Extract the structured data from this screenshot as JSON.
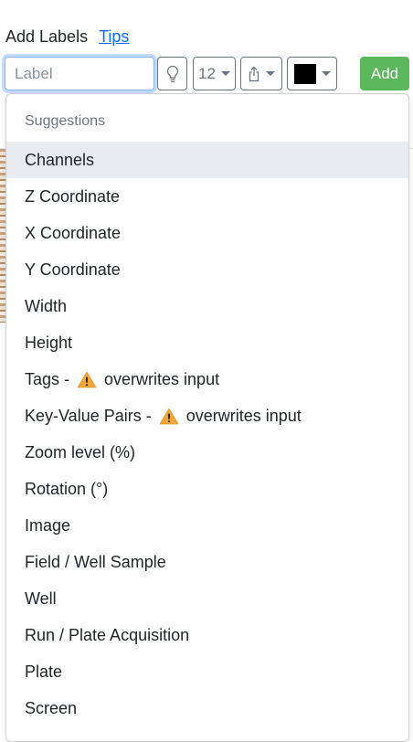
{
  "header": {
    "title": "Add Labels",
    "tips": "Tips"
  },
  "toolbar": {
    "label_placeholder": "Label",
    "font_size": "12",
    "add_label": "Add",
    "color": "#000000"
  },
  "suggestions": {
    "header": "Suggestions",
    "items": [
      {
        "label": "Channels",
        "active": true
      },
      {
        "label": "Z Coordinate"
      },
      {
        "label": "X Coordinate"
      },
      {
        "label": "Y Coordinate"
      },
      {
        "label": "Width"
      },
      {
        "label": "Height"
      },
      {
        "label": "Tags -",
        "warning": "overwrites input"
      },
      {
        "label": "Key-Value Pairs -",
        "warning": "overwrites input"
      },
      {
        "label": "Zoom level (%)"
      },
      {
        "label": "Rotation (°)"
      },
      {
        "label": "Image"
      },
      {
        "label": "Field / Well Sample"
      },
      {
        "label": "Well"
      },
      {
        "label": "Run / Plate Acquisition"
      },
      {
        "label": "Plate"
      },
      {
        "label": "Screen"
      }
    ]
  },
  "icons": {
    "suggestions_button": "lightbulb-icon",
    "position_button": "share-icon",
    "warning": "warning-icon"
  }
}
